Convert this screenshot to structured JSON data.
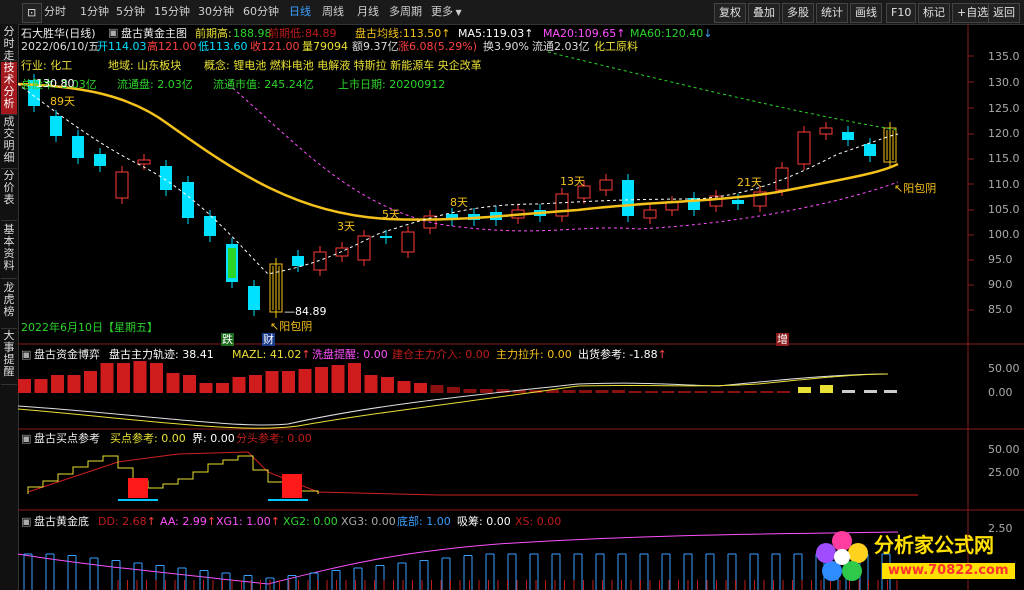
{
  "toolbar": {
    "timeframes": [
      "分时",
      "1分钟",
      "5分钟",
      "15分钟",
      "30分钟",
      "60分钟",
      "日线",
      "周线",
      "月线",
      "多周期",
      "更多"
    ],
    "right_buttons": [
      "复权",
      "叠加",
      "多股",
      "统计",
      "画线",
      "F10",
      "标记",
      "+自选",
      "返回"
    ]
  },
  "sidebar": {
    "tabs": [
      "分时走势",
      "技术分析",
      "成交明细",
      "分价表",
      "基本资料",
      "龙虎榜",
      "大事提醒"
    ]
  },
  "main": {
    "stock_title": "石大胜华(日线)",
    "indicator_name": "盘古黄金主图",
    "prev_high_label": "前期高:",
    "prev_high_value": "188.98",
    "line2_hidden": "前期低:",
    "line2_hidden_value": "84.89",
    "avg_label": "盘古均线:",
    "avg_value": "113.50",
    "ma5_label": "MA5:",
    "ma5_value": "119.03",
    "ma20_label": "MA20:",
    "ma20_value": "109.65",
    "ma60_label": "MA60:",
    "ma60_value": "120.40",
    "date": "2022/06/10/五",
    "open": "开114.03",
    "high": "高121.00",
    "low": "低113.60",
    "close": "收121.00",
    "volume": "量79094",
    "amount": "额9.37亿",
    "change": "涨6.08(5.29%)",
    "turnover": "换3.90%",
    "float": "流通2.03亿",
    "sector": "化工原料",
    "info_industry": "行业:  化工",
    "info_region": "地域:  山东板块",
    "info_concept": "概念:  锂电池 燃料电池 电解液 特斯拉 新能源车 央企改革",
    "info_total": "总股本: 2.03亿",
    "info_float": "流通盘: 2.03亿",
    "info_mcap": "流通市值: 245.24亿",
    "info_list": "上市日期: 20200912",
    "high_price_label": "130.80",
    "days_labels": [
      "89天",
      "3天",
      "5天",
      "8天",
      "13天",
      "21天"
    ],
    "low_price_label": "84.89",
    "yang_bao_yin": "阳包阴",
    "bottom_date": "2022年6月10日【星期五】",
    "marker_die": "跌",
    "marker_cai": "财",
    "marker_zeng": "增",
    "price_axis": [
      "135.0",
      "130.0",
      "125.0",
      "120.0",
      "115.0",
      "110.0",
      "105.0",
      "100.0",
      "95.0",
      "90.0",
      "85.0"
    ]
  },
  "panel1": {
    "name": "盘古资金博弈",
    "l1": "盘古主力轨迹: 38.41",
    "l2": "MAZL: 41.02",
    "l3": "洗盘提醒: 0.00",
    "l4": "建仓主力介入: 0.00",
    "l5": "主力拉升: 0.00",
    "l6": "出货参考: -1.88",
    "axis": [
      "50.00",
      "0.00"
    ]
  },
  "panel2": {
    "name": "盘古买点参考",
    "l1": "买点参考: 0.00",
    "l2": "界: 0.00",
    "l3": "分头参考: 0.00",
    "axis": [
      "50.00",
      "25.00"
    ]
  },
  "panel3": {
    "name": "盘古黄金底",
    "l1": "DD: 2.68",
    "l2": "AA: 2.99",
    "l3": "XG1: 1.00",
    "l4": "XG2: 0.00",
    "l5": "XG3: 0.00",
    "l6": "底部: 1.00",
    "l7": "吸筹: 0.00",
    "l8": "XS: 0.00",
    "axis": [
      "2.50"
    ]
  },
  "watermark": {
    "title": "分析家公式网",
    "url": "www.70822.com"
  },
  "colors": {
    "up": "#ff3c3c",
    "down": "#00e0ff",
    "gold": "#f5c21b",
    "magenta": "#ff50ff",
    "green": "#2bd42b",
    "bg": "#000000"
  }
}
